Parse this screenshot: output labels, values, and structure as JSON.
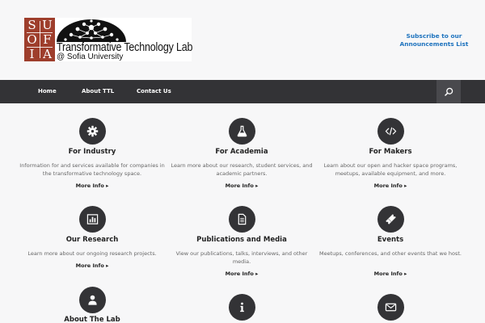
{
  "logo": {
    "letters": [
      "S",
      "U",
      "O",
      "F",
      "I",
      "A"
    ],
    "title": "Transformative Technology Lab",
    "subtitle": "@ Sofia University"
  },
  "header": {
    "subscribe_label": "Subscribe to our Announcements List"
  },
  "nav": {
    "items": [
      "Home",
      "About TTL",
      "Contact Us"
    ],
    "search_icon": "search-icon"
  },
  "cards": [
    {
      "icon": "gear-icon",
      "title": "For Industry",
      "description": "Information for and services available for companies in the transformative technology space.",
      "more": "More Info ▸"
    },
    {
      "icon": "flask-icon",
      "title": "For Academia",
      "description": "Learn more about our research, student services, and academic partners.",
      "more": "More Info ▸"
    },
    {
      "icon": "code-icon",
      "title": "For Makers",
      "description": "Learn about our open and hacker space programs, meetups, available equipment, and more.",
      "more": "More Info ▸"
    },
    {
      "icon": "bar-chart-icon",
      "title": "Our Research",
      "description": "Learn more about our ongoing research projects.",
      "more": "More Info ▸"
    },
    {
      "icon": "document-icon",
      "title": "Publications and Media",
      "description": "View our publications, talks, interviews, and other media.",
      "more": "More Info ▸"
    },
    {
      "icon": "ticket-icon",
      "title": "Events",
      "description": "Meetups, conferences, and other events that we host.",
      "more": "More Info ▸"
    },
    {
      "icon": "user-icon",
      "title": "About The Lab",
      "description": "",
      "more": ""
    },
    {
      "icon": "info-icon",
      "title": "",
      "description": "",
      "more": ""
    },
    {
      "icon": "envelope-icon",
      "title": "",
      "description": "",
      "more": ""
    }
  ],
  "colors": {
    "background": "#f7f7f8",
    "nav_background": "#333336",
    "icon_circle": "#333336",
    "link_blue": "#1e73be",
    "logo_red": "#9e3e2c"
  }
}
